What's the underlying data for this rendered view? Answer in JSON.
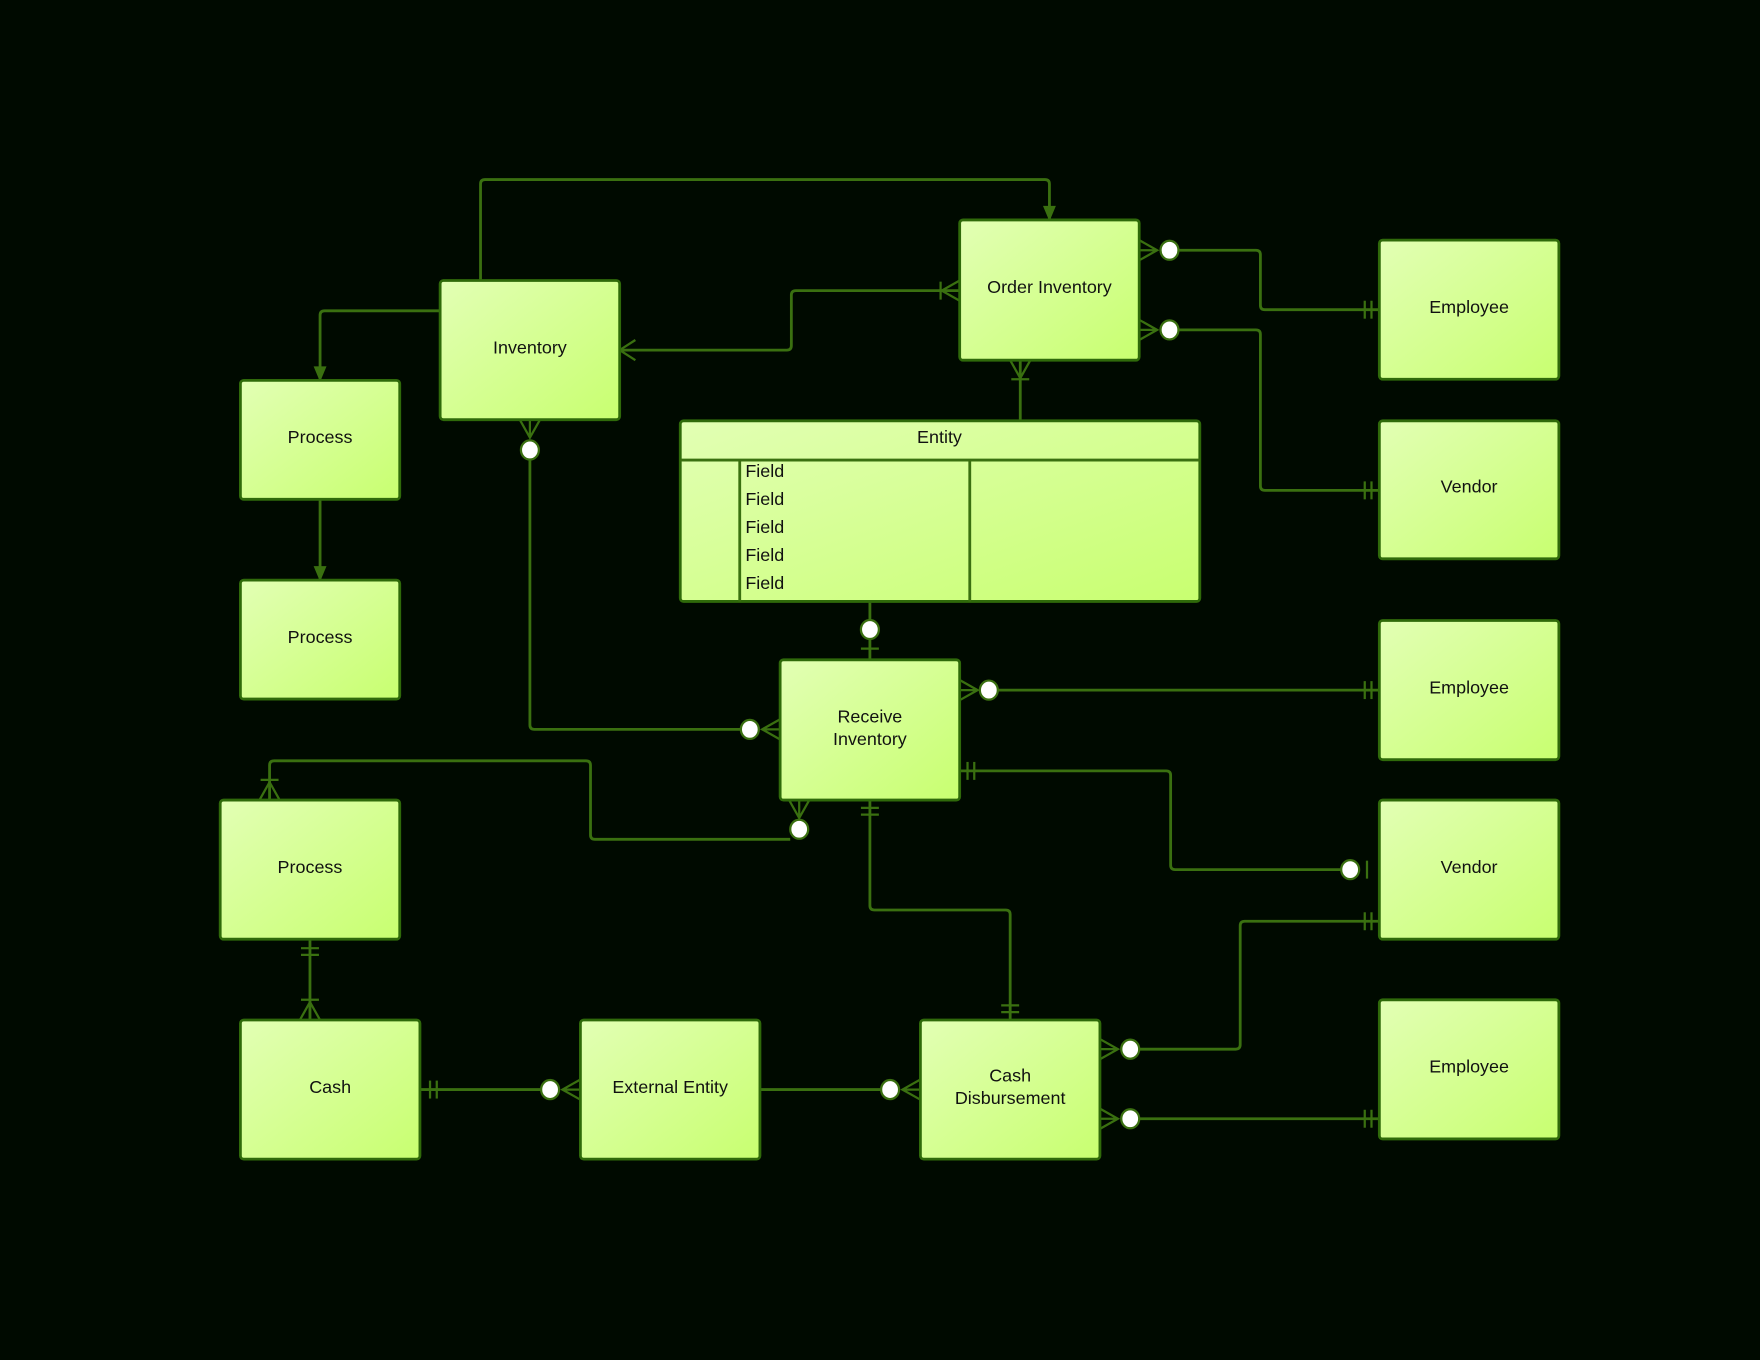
{
  "colors": {
    "background": "#000a00",
    "box_fill_start": "#e2ffb4",
    "box_fill_end": "#c8ff70",
    "stroke": "#3a7010"
  },
  "boxes": {
    "inventory": "Inventory",
    "order_inventory": "Order Inventory",
    "process_1": "Process",
    "process_2": "Process",
    "employee_1": "Employee",
    "vendor_1": "Vendor",
    "employee_2": "Employee",
    "receive_inventory_line1": "Receive",
    "receive_inventory_line2": "Inventory",
    "vendor_2": "Vendor",
    "process_3": "Process",
    "employee_3": "Employee",
    "cash": "Cash",
    "external_entity": "External Entity",
    "cash_disbursement_line1": "Cash",
    "cash_disbursement_line2": "Disbursement"
  },
  "entity_table": {
    "title": "Entity",
    "fields": [
      "Field",
      "Field",
      "Field",
      "Field",
      "Field"
    ]
  }
}
